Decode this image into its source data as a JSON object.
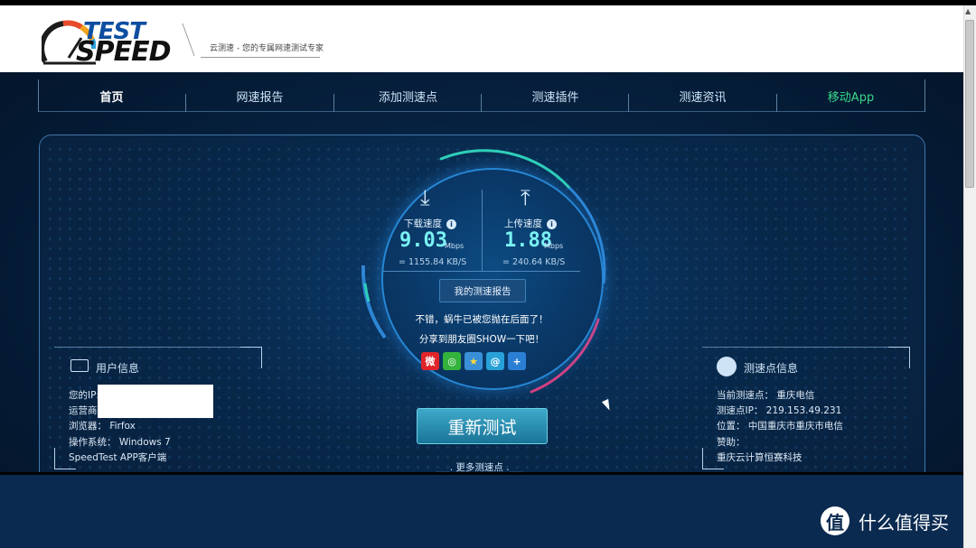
{
  "header": {
    "logo_line1": "TEST",
    "logo_line2": "SPEED",
    "slogan": "云测速 - 您的专属网速测试专家"
  },
  "nav": {
    "items": [
      {
        "label": "首页"
      },
      {
        "label": "网速报告"
      },
      {
        "label": "添加测速点"
      },
      {
        "label": "测速插件"
      },
      {
        "label": "测速资讯"
      },
      {
        "label": "移动App"
      }
    ],
    "active_color": "#ffffff",
    "app_color": "#3ad88a"
  },
  "speed": {
    "download": {
      "label": "下载速度",
      "value": "9.03",
      "unit": "Mbps",
      "kb": "= 1155.84  KB/S"
    },
    "upload": {
      "label": "上传速度",
      "value": "1.88",
      "unit": "Mbps",
      "kb": "= 240.64  KB/S"
    },
    "report_button": "我的测速报告",
    "message1": "不错，蜗牛已被您抛在后面了！",
    "message2": "分享到朋友圈SHOW一下吧！",
    "share_icons": [
      "weibo-icon",
      "wechat-icon",
      "favorite-icon",
      "tencent-weibo-icon",
      "plus-share-icon"
    ]
  },
  "retest_button": "重新测试",
  "more_nodes": "___. 更多测速点 .___",
  "user_info": {
    "title": "用户信息",
    "ip_label": "您的IP:",
    "isp_label": "运营商",
    "browser": "浏览器：  Firfox",
    "os": "操作系统：  Windows 7",
    "app": "SpeedTest APP客户端"
  },
  "node_info": {
    "title": "测速点信息",
    "current": "当前测速点：  重庆电信",
    "ip": "测速点IP：  219.153.49.231",
    "location": "位置：  中国重庆市重庆市电信",
    "sponsor": "赞助：",
    "sponsor_name": "重庆云计算恒赛科技"
  },
  "watermark": {
    "logo": "值",
    "text": "什么值得买"
  },
  "colors": {
    "accent": "#7af1f3",
    "panel_border": "#3f77aa",
    "brand_blue": "#0d4ea0"
  }
}
